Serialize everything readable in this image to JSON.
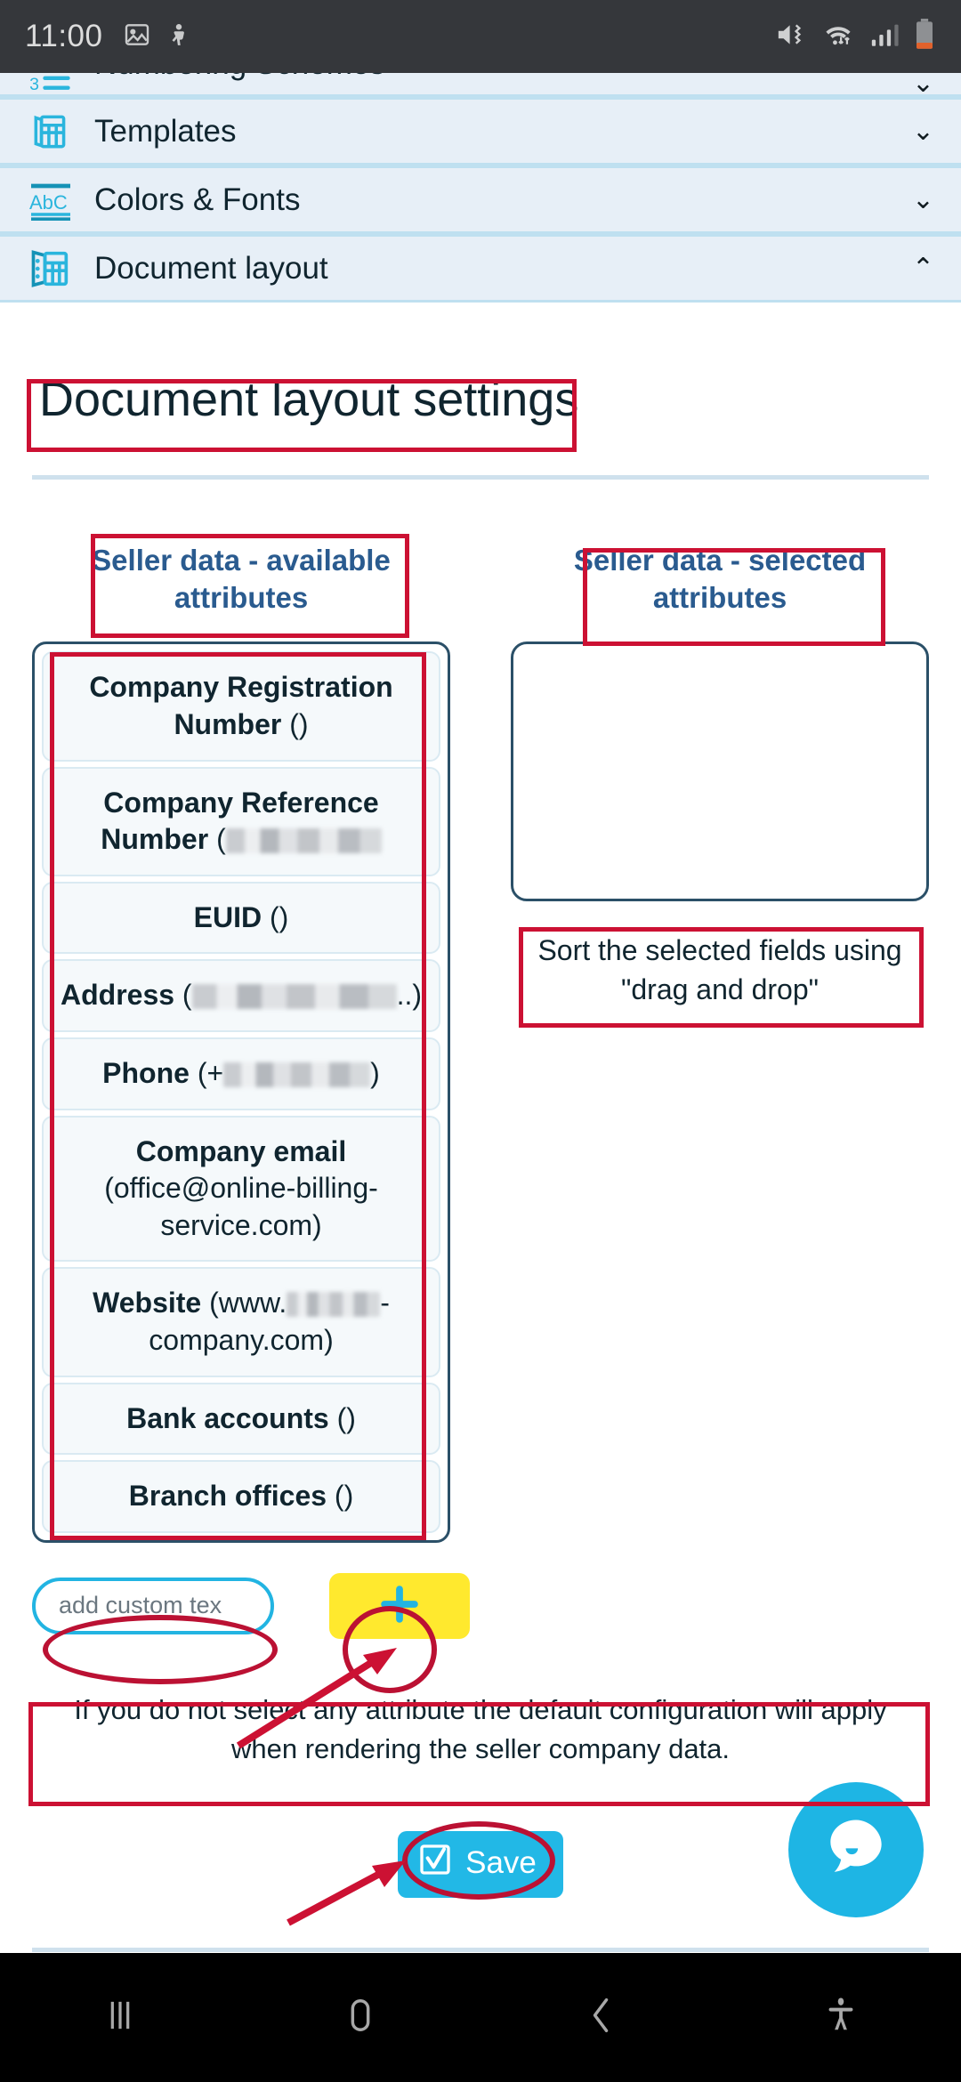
{
  "statusbar": {
    "time": "11:00",
    "left_icons": [
      "image-icon",
      "debug-icon"
    ],
    "right_icons": [
      "mute-vibrate-icon",
      "wifi-icon",
      "signal-icon",
      "battery-icon"
    ]
  },
  "accordion": {
    "items": [
      {
        "label": "Numbering Schemes",
        "icon": "numbering-icon",
        "chevron": "⌄",
        "expanded": false,
        "partial": true
      },
      {
        "label": "Templates",
        "icon": "templates-icon",
        "chevron": "⌄",
        "expanded": false,
        "partial": false
      },
      {
        "label": "Colors & Fonts",
        "icon": "abc-icon",
        "chevron": "⌄",
        "expanded": false,
        "partial": false
      },
      {
        "label": "Document layout",
        "icon": "document-layout-icon",
        "chevron": "⌃",
        "expanded": true,
        "partial": false
      }
    ]
  },
  "page": {
    "title": "Document layout settings",
    "available_heading": "Seller data - available attributes",
    "selected_heading": "Seller data - selected attributes",
    "available_attributes": [
      {
        "name": "Company Registration Number",
        "value": "()",
        "redacted": false
      },
      {
        "name": "Company Reference Number",
        "value": "(",
        "redacted": true,
        "redact_width": 175,
        "value_end": ""
      },
      {
        "name": "EUID",
        "value": "()",
        "redacted": false
      },
      {
        "name": "Address",
        "value": "(",
        "redacted": true,
        "redact_width": 230,
        "value_end": "..)"
      },
      {
        "name": "Phone",
        "value": "(+",
        "redacted": true,
        "redact_width": 165,
        "value_end": ")"
      },
      {
        "name": "Company email",
        "value": "(office@online-billing-service.com)",
        "redacted": false
      },
      {
        "name": "Website",
        "value": "(www.",
        "redacted": true,
        "redact_width": 105,
        "value_end": "-company.com)"
      },
      {
        "name": "Bank accounts",
        "value": "()",
        "redacted": false
      },
      {
        "name": "Branch offices",
        "value": "()",
        "redacted": false
      }
    ],
    "drag_note": "Sort the selected fields using \"drag and drop\"",
    "custom_text_placeholder": "add custom tex",
    "custom_text_value": "",
    "add_button_label": "+",
    "info_note": "If you do not select any attribute the default configuration will apply when rendering the seller company data.",
    "save_label": "Save"
  },
  "chat": {
    "icon": "chat-bubble-icon"
  },
  "navbar": {
    "buttons": [
      {
        "name": "recents",
        "icon": "recents-icon"
      },
      {
        "name": "home",
        "icon": "home-icon"
      },
      {
        "name": "back",
        "icon": "back-icon"
      },
      {
        "name": "accessibility",
        "icon": "accessibility-icon"
      }
    ]
  },
  "colors": {
    "accent_cyan": "#22b4e2",
    "accordion_bg": "#e7eff7",
    "divider": "#bfe0f0",
    "annotation_red": "#cc1133",
    "add_button_yellow": "#ffe92e",
    "heading_blue": "#2a5b8f",
    "text_dark": "#10252f"
  }
}
